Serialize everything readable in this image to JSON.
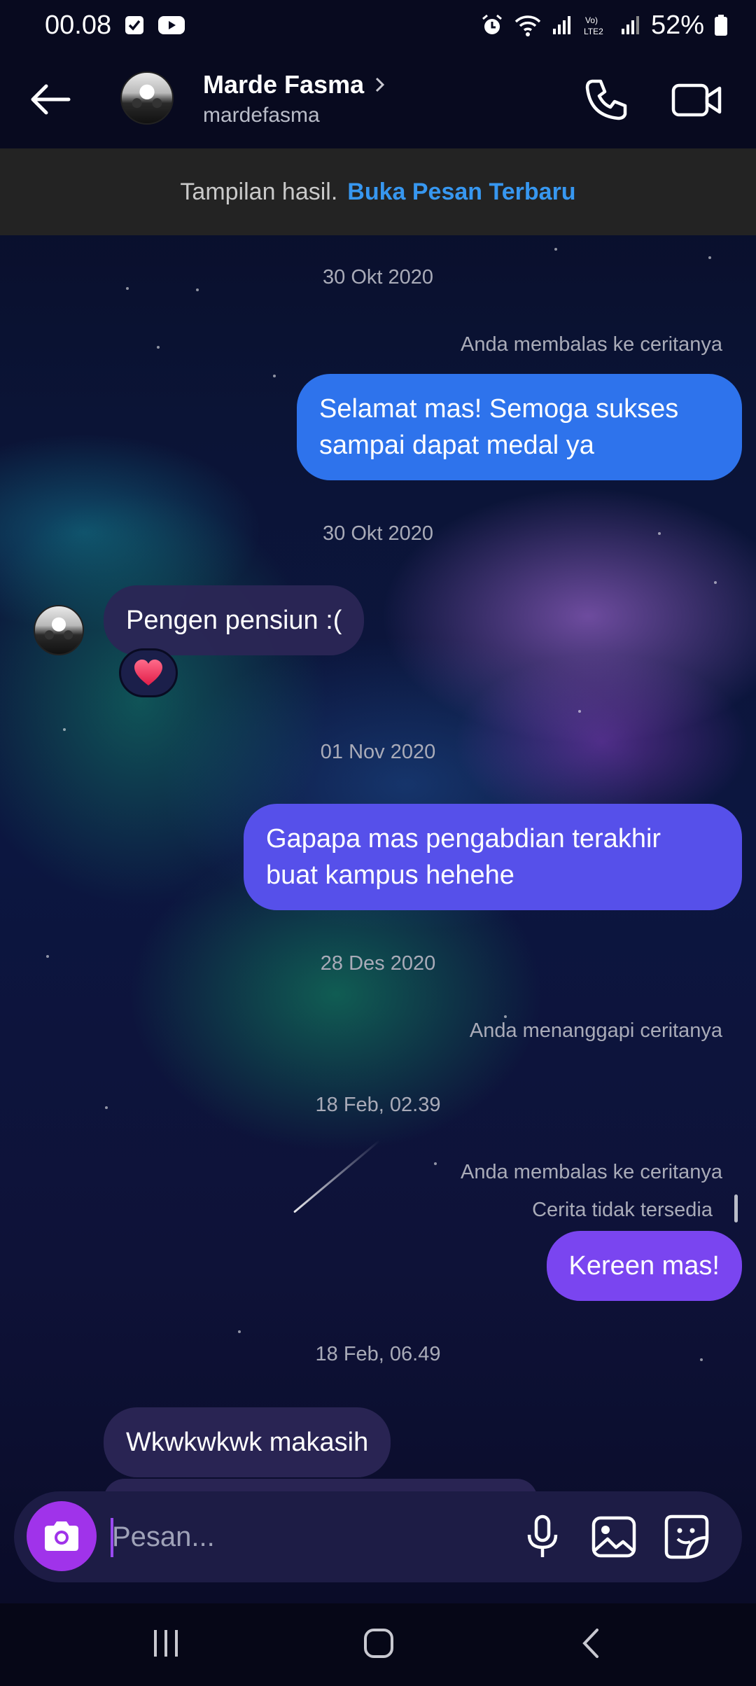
{
  "status_bar": {
    "time": "00.08",
    "battery": "52%"
  },
  "header": {
    "contact_name": "Marde Fasma",
    "contact_handle": "mardefasma"
  },
  "banner": {
    "text": "Tampilan hasil.",
    "link": "Buka Pesan Terbaru"
  },
  "messages": {
    "date_1": "30 Okt 2020",
    "note_1": "Anda membalas ke ceritanya",
    "out_1": "Selamat mas! Semoga sukses sampai dapat medal ya",
    "date_2": "30 Okt 2020",
    "in_1": "Pengen pensiun :(",
    "reaction_1": "heart",
    "date_3": "01 Nov 2020",
    "out_2": "Gapapa mas pengabdian terakhir buat kampus hehehe",
    "date_4": "28 Des 2020",
    "note_2": "Anda menanggapi ceritanya",
    "date_5": "18 Feb, 02.39",
    "note_3": "Anda membalas ke ceritanya",
    "note_4": "Cerita tidak tersedia",
    "out_3": "Kereen mas!",
    "date_6": "18 Feb, 06.49",
    "in_2": "Wkwkwkwk makasih"
  },
  "composer": {
    "placeholder": "Pesan..."
  },
  "colors": {
    "bubble_out_1": "#2e73ec",
    "bubble_out_2": "#5650ea",
    "bubble_out_3": "#7a45f0",
    "bubble_in": "#2b2655",
    "camera_button": "#a033ea",
    "link": "#3797f0"
  },
  "icons": {
    "back": "back-arrow-icon",
    "call": "phone-icon",
    "video": "video-camera-icon",
    "camera": "camera-icon",
    "mic": "microphone-icon",
    "gallery": "image-icon",
    "sticker": "sticker-icon",
    "reaction": "heart-icon"
  }
}
